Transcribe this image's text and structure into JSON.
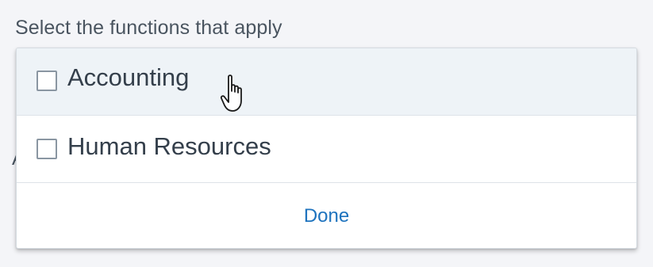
{
  "form": {
    "label": "Select the functions that apply",
    "underlay_char": "A"
  },
  "dropdown": {
    "options": [
      {
        "label": "Accounting",
        "checked": false,
        "hovered": true
      },
      {
        "label": "Human Resources",
        "checked": false,
        "hovered": false
      }
    ],
    "done_label": "Done"
  },
  "colors": {
    "accent": "#1e73be",
    "hover_background": "#eef3f7",
    "text": "#343f4b"
  },
  "icons": {
    "cursor": "hand-pointer-icon",
    "checkbox": "checkbox-unchecked-icon"
  }
}
